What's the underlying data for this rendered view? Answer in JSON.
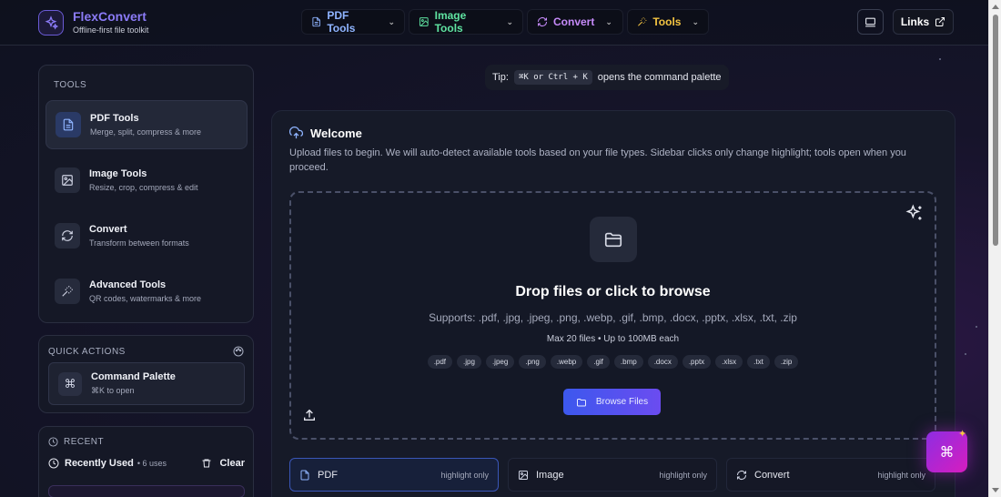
{
  "brand": {
    "name": "FlexConvert",
    "tagline": "Offline-first file toolkit"
  },
  "nav": {
    "pdf": "PDF Tools",
    "image": "Image Tools",
    "convert": "Convert",
    "tools": "Tools",
    "links": "Links"
  },
  "tip": {
    "prefix": "Tip:",
    "shortcut": "⌘K or Ctrl + K",
    "suffix": "opens the command palette"
  },
  "sidebar": {
    "tools_title": "TOOLS",
    "items": [
      {
        "name": "PDF Tools",
        "desc": "Merge, split, compress & more"
      },
      {
        "name": "Image Tools",
        "desc": "Resize, crop, compress & edit"
      },
      {
        "name": "Convert",
        "desc": "Transform between formats"
      },
      {
        "name": "Advanced Tools",
        "desc": "QR codes, watermarks & more"
      }
    ],
    "quick_actions_title": "QUICK ACTIONS",
    "command_palette": {
      "title": "Command Palette",
      "hint": "⌘K to open"
    },
    "recent_title": "RECENT",
    "recently_used": "Recently Used",
    "recent_count": "• 6 uses",
    "clear": "Clear"
  },
  "main": {
    "welcome_title": "Welcome",
    "welcome_desc": "Upload files to begin. We will auto-detect available tools based on your file types. Sidebar clicks only change highlight; tools open when you proceed.",
    "drop_title": "Drop files or click to browse",
    "supports": "Supports: .pdf, .jpg, .jpeg, .png, .webp, .gif, .bmp, .docx, .pptx, .xlsx, .txt, .zip",
    "limits": "Max 20 files • Up to 100MB each",
    "chips": [
      ".pdf",
      ".jpg",
      ".jpeg",
      ".png",
      ".webp",
      ".gif",
      ".bmp",
      ".docx",
      ".pptx",
      ".xlsx",
      ".txt",
      ".zip"
    ],
    "browse": "Browse Files",
    "categories": [
      {
        "label": "PDF",
        "hint": "highlight only"
      },
      {
        "label": "Image",
        "hint": "highlight only"
      },
      {
        "label": "Convert",
        "hint": "highlight only"
      }
    ]
  },
  "fab": {
    "symbol": "⌘"
  },
  "colors": {
    "accent": "#8b7bf7",
    "pdf": "#8fb4ff",
    "image": "#5fe3a1",
    "convert": "#c58af9",
    "tools": "#f5c542"
  }
}
